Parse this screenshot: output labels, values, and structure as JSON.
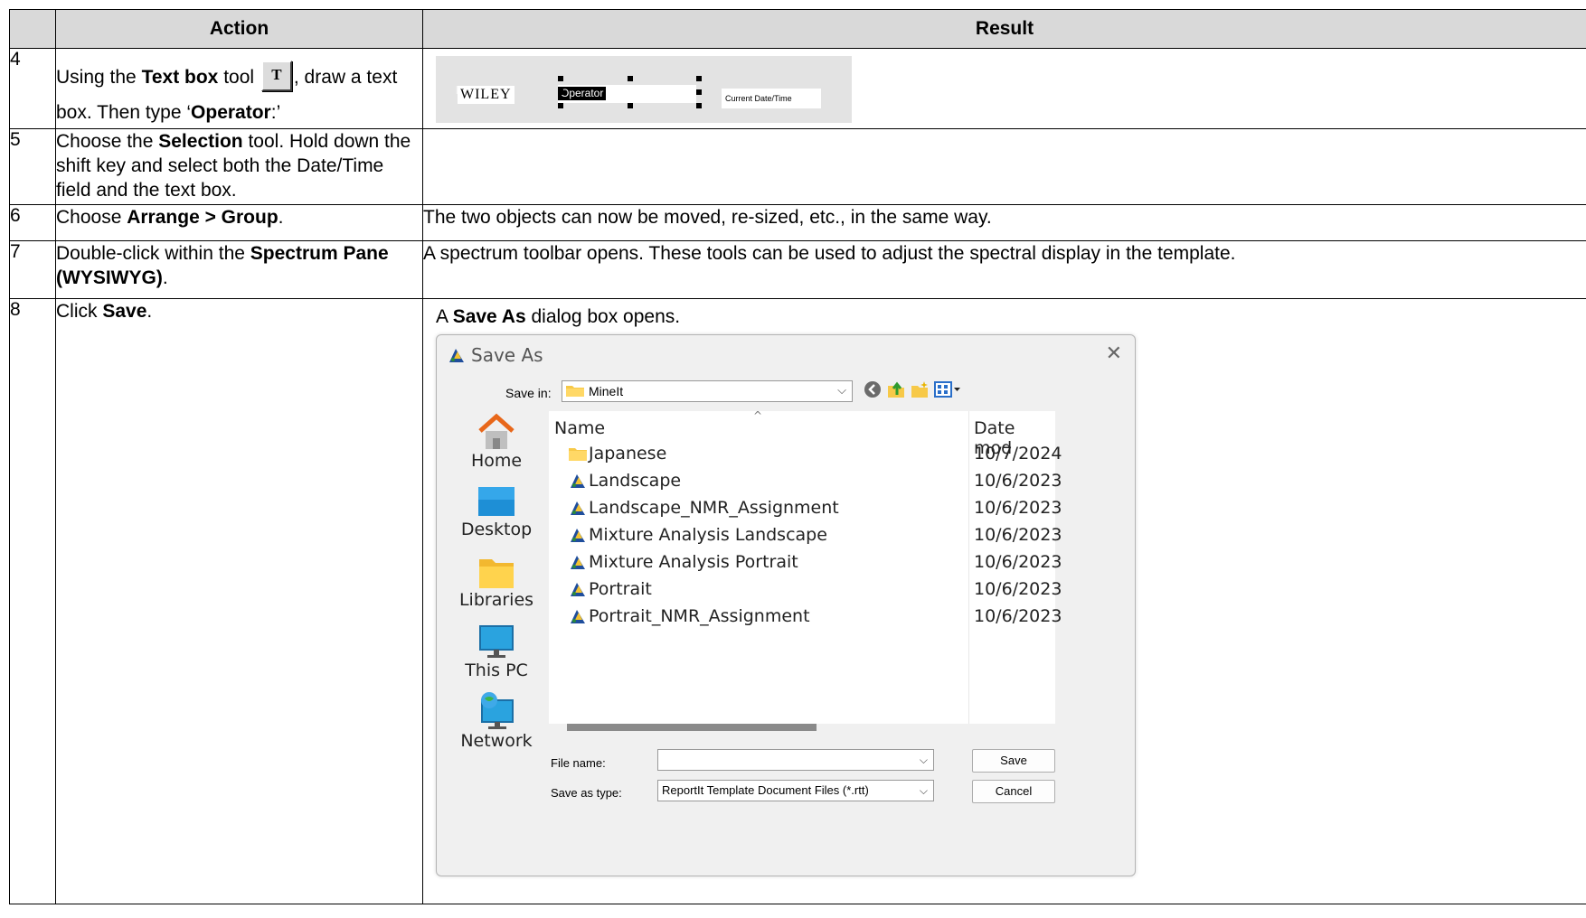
{
  "table": {
    "header_action": "Action",
    "header_result": "Result"
  },
  "rows": [
    {
      "num": "4",
      "action_parts": [
        "Using the ",
        "Text box",
        " tool ",
        ", draw a text box. Then type ‘",
        "Operator",
        ":’"
      ],
      "tool_icon_letter": "T",
      "result_image": {
        "wiley": "WILEY",
        "operator_text": "Operator",
        "current_datetime": "Current Date/Time"
      }
    },
    {
      "num": "5",
      "action_parts": [
        "Choose the ",
        "Selection",
        " tool. Hold down the shift key and select both the Date/Time field and the text box."
      ]
    },
    {
      "num": "6",
      "action_parts": [
        "Choose ",
        "Arrange > Group",
        "."
      ],
      "result": "The two objects can now be moved, re-sized, etc., in the same way."
    },
    {
      "num": "7",
      "action_parts": [
        "Double-click within the ",
        "Spectrum Pane (WYSIWYG)",
        "."
      ],
      "result": "A spectrum toolbar opens. These tools can be used to adjust the spectral display in the template."
    },
    {
      "num": "8",
      "action_parts": [
        "Click ",
        "Save",
        "."
      ],
      "result_parts": [
        "A ",
        "Save As",
        " dialog box opens."
      ]
    }
  ],
  "dialog": {
    "title": "Save As",
    "save_in_label": "Save in:",
    "save_in_value": "MineIt",
    "places": [
      "Home",
      "Desktop",
      "Libraries",
      "This PC",
      "Network"
    ],
    "col_name": "Name",
    "col_date": "Date mod",
    "files": [
      {
        "name": "Japanese",
        "date": "10/7/2024",
        "icon": "folder-icon"
      },
      {
        "name": "Landscape",
        "date": "10/6/2023",
        "icon": "reportit-file-icon"
      },
      {
        "name": "Landscape_NMR_Assignment",
        "date": "10/6/2023",
        "icon": "reportit-file-icon"
      },
      {
        "name": "Mixture Analysis Landscape",
        "date": "10/6/2023",
        "icon": "reportit-file-icon"
      },
      {
        "name": "Mixture Analysis Portrait",
        "date": "10/6/2023",
        "icon": "reportit-file-icon"
      },
      {
        "name": "Portrait",
        "date": "10/6/2023",
        "icon": "reportit-file-icon"
      },
      {
        "name": "Portrait_NMR_Assignment",
        "date": "10/6/2023",
        "icon": "reportit-file-icon"
      }
    ],
    "file_name_label": "File name:",
    "file_name_value": "",
    "save_type_label": "Save as type:",
    "save_type_value": "ReportIt Template Document Files (*.rtt)",
    "save_button": "Save",
    "cancel_button": "Cancel",
    "close_glyph": "✕"
  }
}
